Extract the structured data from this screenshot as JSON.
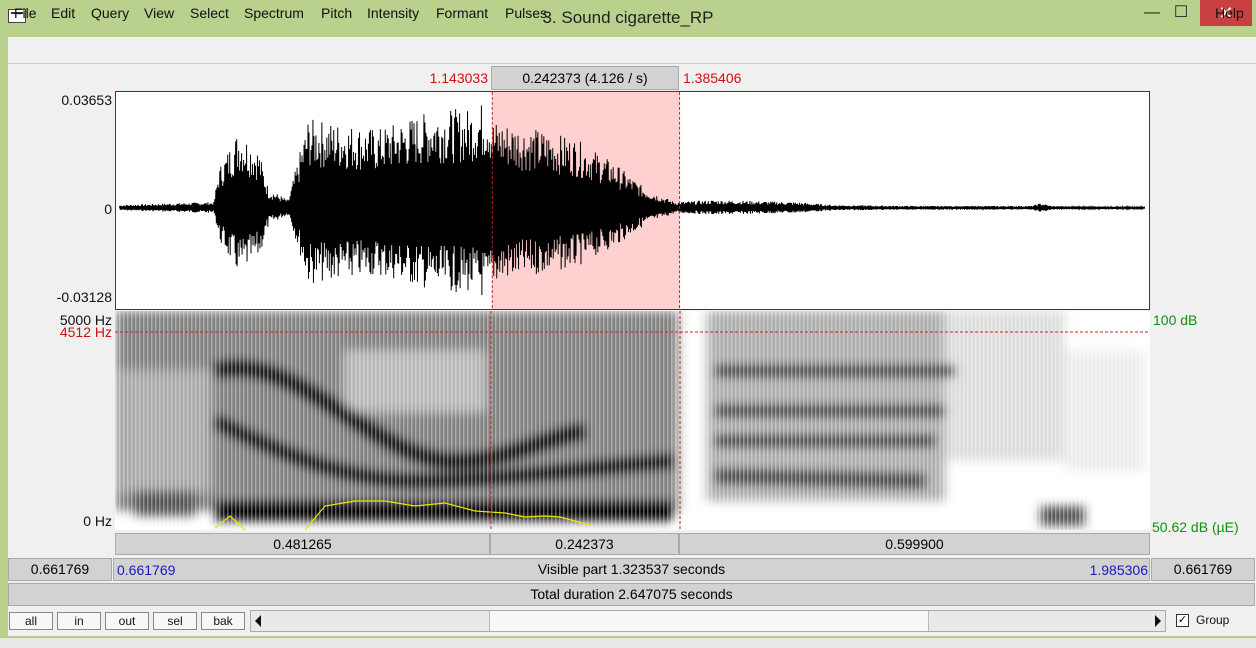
{
  "window": {
    "title": "3. Sound cigarette_RP",
    "minimize": "—",
    "maximize": "☐",
    "close": "✕"
  },
  "menu": [
    "File",
    "Edit",
    "Query",
    "View",
    "Select",
    "Spectrum",
    "Pitch",
    "Intensity",
    "Formant",
    "Pulses"
  ],
  "menu_help": "Help",
  "selection": {
    "start": "1.143033",
    "duration_label": "0.242373 (4.126 / s)",
    "end": "1.385406"
  },
  "waveform": {
    "ymax": "0.03653",
    "zero": "0",
    "ymin": "-0.03128"
  },
  "spectrogram": {
    "fmax": "5000 Hz",
    "cursor_freq": "4512 Hz",
    "fmin": "0 Hz",
    "db_max": "100 dB",
    "db_min": "50.62 dB (µE)"
  },
  "intervals": {
    "left": "0.481265",
    "selected": "0.242373",
    "right": "0.599900"
  },
  "visible": {
    "outer_left": "0.661769",
    "start": "0.661769",
    "label": "Visible part 1.323537 seconds",
    "end": "1.985306",
    "outer_right": "0.661769"
  },
  "total_label": "Total duration 2.647075 seconds",
  "buttons": {
    "all": "all",
    "in": "in",
    "out": "out",
    "sel": "sel",
    "bak": "bak"
  },
  "group": {
    "label": "Group",
    "checked": true,
    "check_glyph": "✓"
  },
  "colors": {
    "title_bar": "#b9d18c",
    "selection_fill": "#ffd0d0",
    "cursor_line": "#cc2020",
    "pitch_curve": "#e8e800"
  }
}
